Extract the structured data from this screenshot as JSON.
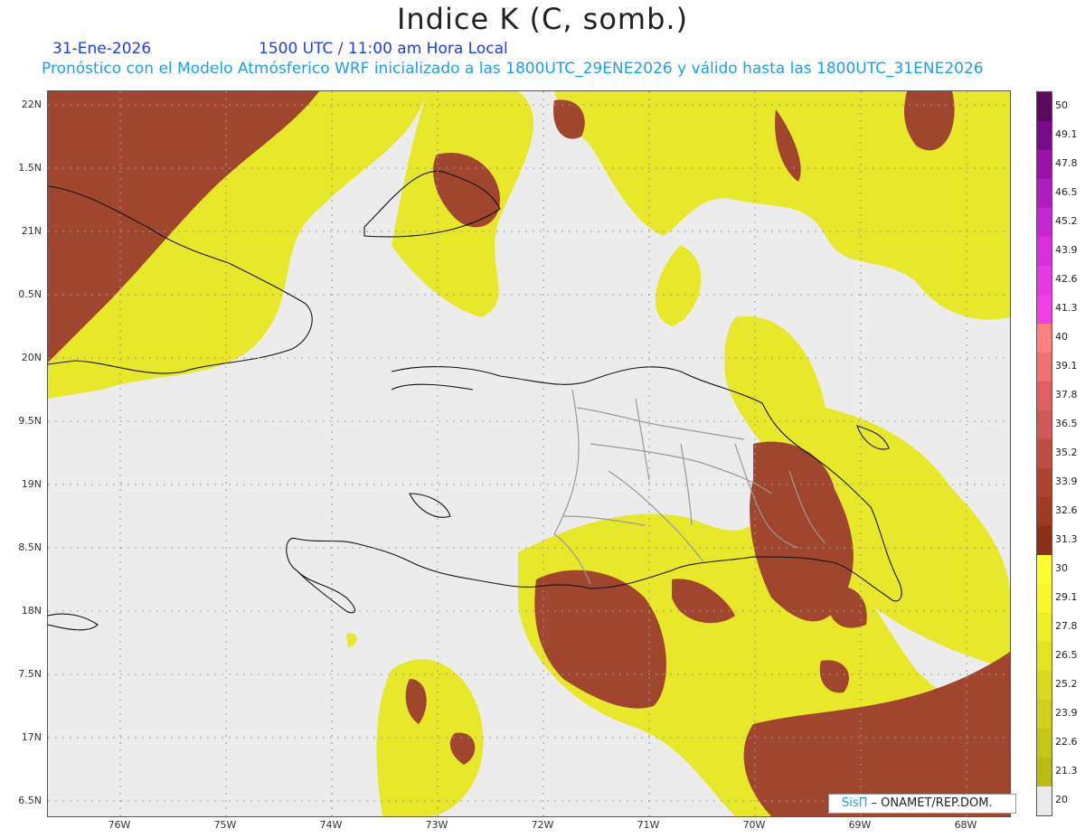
{
  "header": {
    "title": "Indice K (C, somb.)",
    "date": "31-Ene-2026",
    "time": "1500 UTC / 11:00 am Hora Local",
    "forecast": "Pronóstico con el Modelo Atmósferico WRF inicializado a las 1800UTC_29ENE2026 y válido hasta las  1800UTC_31ENE2026"
  },
  "axes": {
    "lat_labels": [
      "22N",
      "1.5N",
      "21N",
      "0.5N",
      "20N",
      "9.5N",
      "19N",
      "8.5N",
      "18N",
      "7.5N",
      "17N",
      "6.5N"
    ],
    "lon_labels": [
      "76W",
      "75W",
      "74W",
      "73W",
      "72W",
      "71W",
      "70W",
      "69W",
      "68W"
    ]
  },
  "colorbar": {
    "labels": [
      "50",
      "49.1",
      "47.8",
      "46.5",
      "45.2",
      "43.9",
      "42.6",
      "41.3",
      "40",
      "39.1",
      "37.8",
      "36.5",
      "35.2",
      "33.9",
      "32.6",
      "31.3",
      "30",
      "29.1",
      "27.8",
      "26.5",
      "25.2",
      "23.9",
      "22.6",
      "21.3",
      "20"
    ],
    "colors": [
      "#5a0a5a",
      "#7a0a8a",
      "#9a12aa",
      "#b01cc0",
      "#c626d0",
      "#d830dc",
      "#e838e4",
      "#f23ee8",
      "#ff8080",
      "#f07070",
      "#e06060",
      "#d05858",
      "#c04c42",
      "#b0432f",
      "#9e3a22",
      "#8a3018",
      "#ffff30",
      "#f8f828",
      "#eeee24",
      "#e4e420",
      "#dada1c",
      "#d0d018",
      "#c6c614",
      "#bcbc10",
      "#ebebeb"
    ]
  },
  "credit": {
    "brand": "SisΠ",
    "org": " – ONAMET/REP.DOM."
  },
  "colors": {
    "high_k": "#a0462e",
    "mid_k": "#e8e820",
    "low": "#ececec",
    "border": "#999999",
    "coast": "#111111"
  }
}
